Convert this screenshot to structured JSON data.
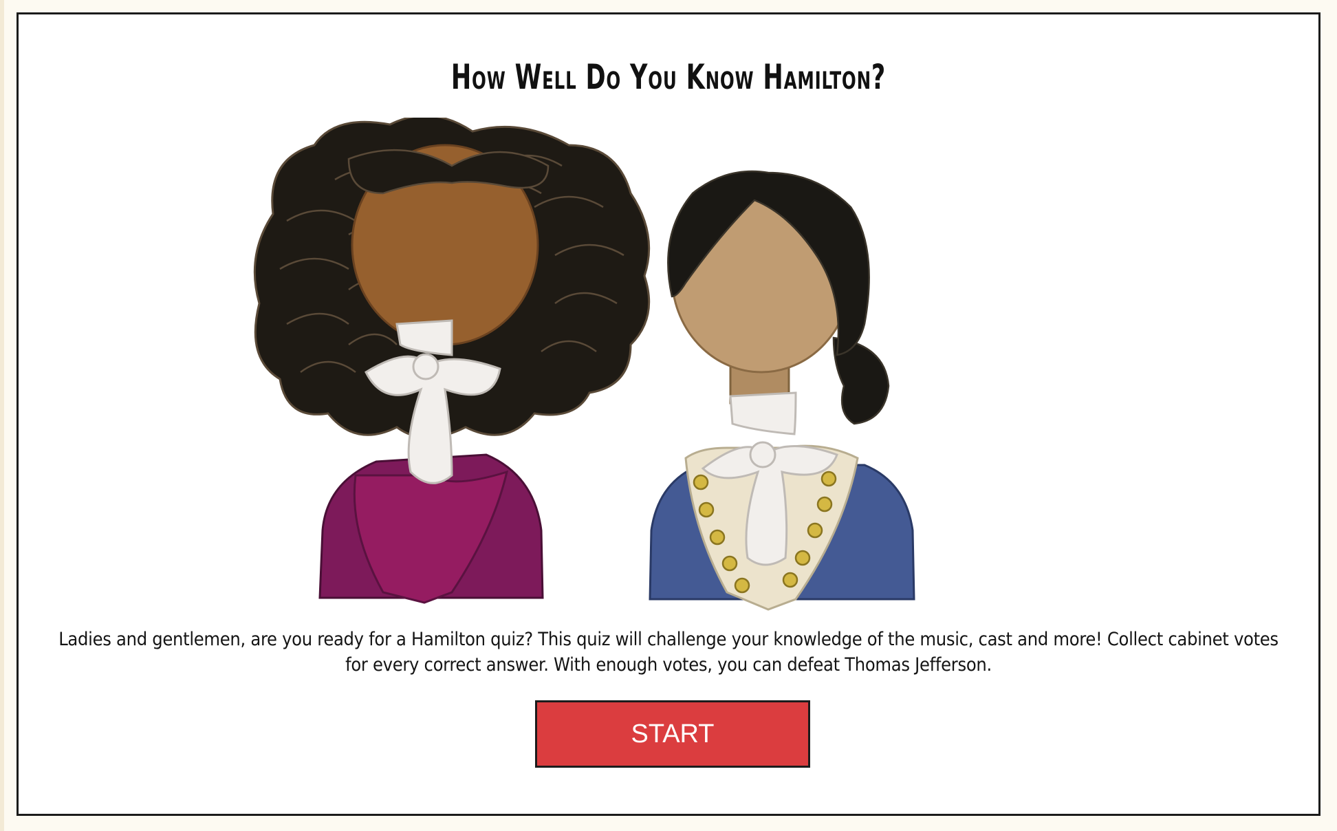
{
  "quiz": {
    "title": "How Well Do You Know Hamilton?",
    "description": "Ladies and gentlemen, are you ready for a Hamilton quiz? This quiz will challenge your knowledge of the music, cast and more! Collect cabinet votes for every correct answer. With enough votes, you can defeat Thomas Jefferson.",
    "start_label": "START"
  },
  "illustration": {
    "characters": [
      {
        "icon": "jefferson-character-illustration",
        "coat_color": "#7d1a5a",
        "skin_color": "#96602e",
        "hair_color": "#1e1a14"
      },
      {
        "icon": "hamilton-character-illustration",
        "coat_color": "#445a94",
        "skin_color": "#c09c72",
        "hair_color": "#1a1814"
      }
    ]
  },
  "colors": {
    "start_button": "#db3d3f",
    "frame_border": "#1b1b1b"
  }
}
